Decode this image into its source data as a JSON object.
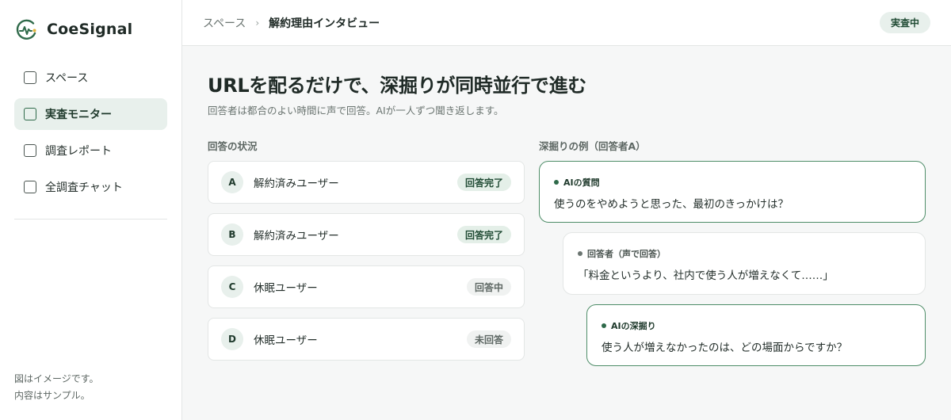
{
  "app": {
    "name": "CoeSignal"
  },
  "sidebar": {
    "items": [
      {
        "label": "スペース",
        "active": false
      },
      {
        "label": "実査モニター",
        "active": true
      },
      {
        "label": "調査レポート",
        "active": false
      },
      {
        "label": "全調査チャット",
        "active": false
      }
    ],
    "note_line1": "図はイメージです。",
    "note_line2": "内容はサンプル。"
  },
  "header": {
    "breadcrumb_root": "スペース",
    "breadcrumb_sep": "›",
    "breadcrumb_current": "解約理由インタビュー",
    "status": "実査中"
  },
  "main": {
    "title": "URLを配るだけで、深掘りが同時並行で進む",
    "subtitle": "回答者は都合のよい時間に声で回答。AIが一人ずつ聞き返します。",
    "responses_label": "回答の状況",
    "responses": [
      {
        "letter": "A",
        "name": "解約済みユーザー",
        "status": "回答完了",
        "state": "done"
      },
      {
        "letter": "B",
        "name": "解約済みユーザー",
        "status": "回答完了",
        "state": "done"
      },
      {
        "letter": "C",
        "name": "休眠ユーザー",
        "status": "回答中",
        "state": "muted"
      },
      {
        "letter": "D",
        "name": "休眠ユーザー",
        "status": "未回答",
        "state": "muted"
      }
    ],
    "thread_label": "深掘りの例（回答者A）",
    "thread": [
      {
        "tag": "AIの質問",
        "text": "使うのをやめようと思った、最初のきっかけは？",
        "role": "ai"
      },
      {
        "tag": "回答者（声で回答）",
        "text": "「料金というより、社内で使う人が増えなくて……」",
        "role": "user"
      },
      {
        "tag": "AIの深掘り",
        "text": "使う人が増えなかったのは、どの場面からですか？",
        "role": "ai"
      }
    ]
  },
  "colors": {
    "accent": "#2f6a4a",
    "accent_light": "#e8f0ec",
    "border": "#e3e6e5"
  }
}
